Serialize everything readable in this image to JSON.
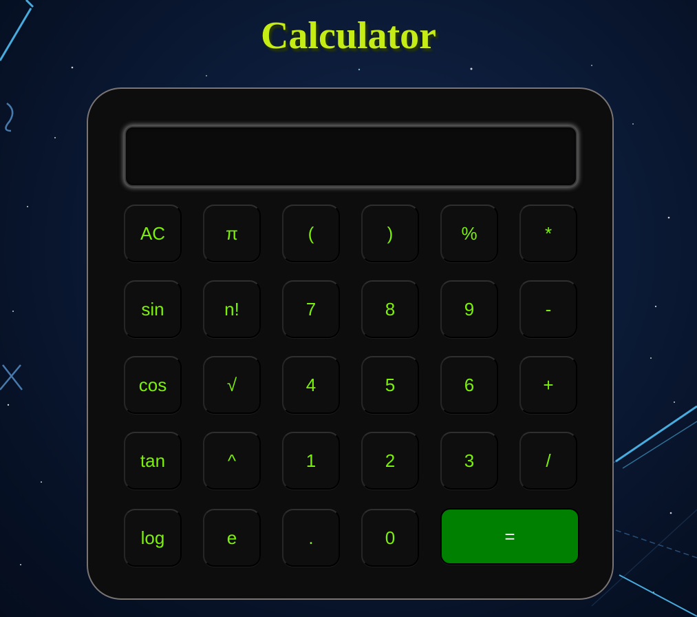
{
  "title": "Calculator",
  "display": {
    "value": ""
  },
  "colors": {
    "accent_text": "#7cf00a",
    "title": "#c6ec16",
    "equals_bg": "#008000",
    "equals_text": "#ffffff",
    "body_bg": "#0d0d0d"
  },
  "keys": [
    [
      "AC",
      "π",
      "(",
      ")",
      "%",
      "*"
    ],
    [
      "sin",
      "n!",
      "7",
      "8",
      "9",
      "-"
    ],
    [
      "cos",
      "√",
      "4",
      "5",
      "6",
      "+"
    ],
    [
      "tan",
      "^",
      "1",
      "2",
      "3",
      "/"
    ],
    [
      "log",
      "e",
      ".",
      "0",
      "="
    ]
  ]
}
